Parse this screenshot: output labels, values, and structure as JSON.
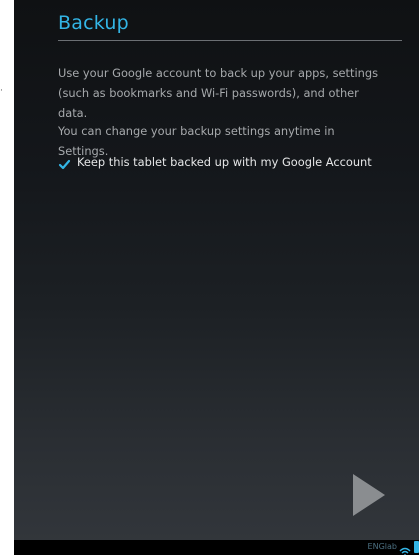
{
  "screen": {
    "title": "Backup",
    "paragraph_1": "Use your Google account to back up your apps, settings (such as bookmarks and Wi-Fi passwords), and other data.",
    "paragraph_2": "You can change your backup settings anytime in Settings.",
    "checkbox": {
      "label": "Keep this tablet backed up with my Google Account",
      "checked": true
    },
    "next_icon": "play-arrow-icon"
  },
  "status_bar": {
    "carrier_text": "ENGlab",
    "wifi_icon": "wifi-icon",
    "battery_icon": "battery-icon"
  },
  "colors": {
    "accent": "#33b5e5",
    "body_text": "#a6a9ac",
    "label_text": "#e6e7e8"
  }
}
